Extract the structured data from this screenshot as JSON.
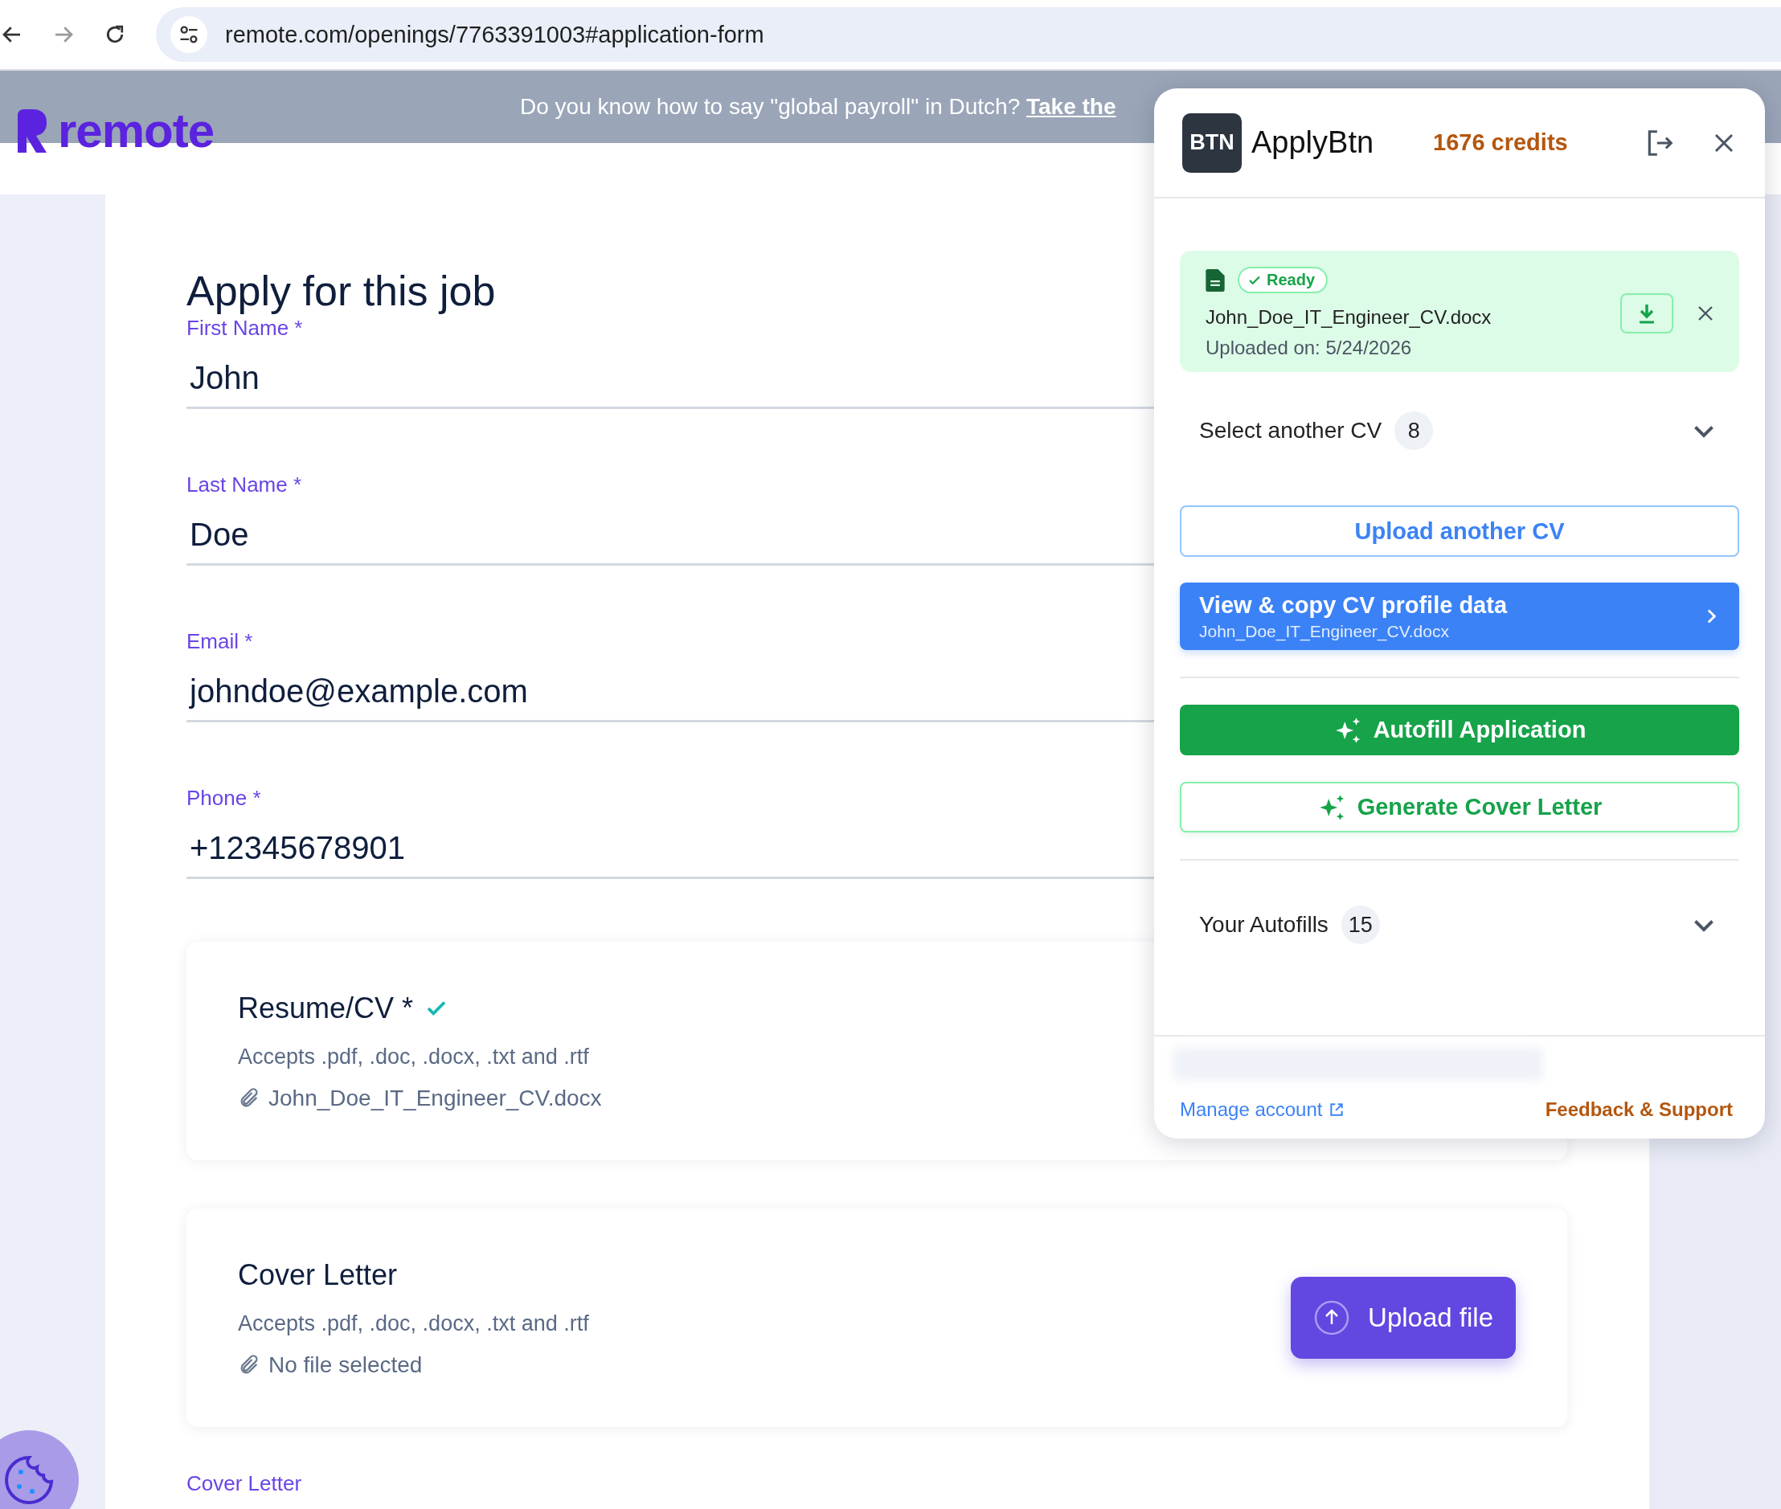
{
  "browser": {
    "url": "remote.com/openings/7763391003#application-form"
  },
  "banner": {
    "text": "Do you know how to say \"global payroll\" in Dutch?",
    "link": "Take the"
  },
  "logo": {
    "text": "remote"
  },
  "form": {
    "title": "Apply for this job",
    "fields": [
      {
        "label": "First Name *",
        "value": "John"
      },
      {
        "label": "Last Name *",
        "value": "Doe"
      },
      {
        "label": "Email *",
        "value": "johndoe@example.com"
      },
      {
        "label": "Phone *",
        "value": "+12345678901"
      }
    ],
    "uploads": [
      {
        "title": "Resume/CV *",
        "done": true,
        "accepts": "Accepts .pdf, .doc, .docx, .txt and .rtf",
        "file": "John_Doe_IT_Engineer_CV.docx"
      },
      {
        "title": "Cover Letter",
        "done": false,
        "accepts": "Accepts .pdf, .doc, .docx, .txt and .rtf",
        "file": "No file selected",
        "button": "Upload file"
      }
    ],
    "next_label": "Cover Letter"
  },
  "panel": {
    "logo": "BTN",
    "name": "ApplyBtn",
    "credits": "1676 credits",
    "cv": {
      "status": "Ready",
      "file": "John_Doe_IT_Engineer_CV.docx",
      "uploaded": "Uploaded on: 5/24/2026"
    },
    "select": {
      "label": "Select another CV",
      "count": "8",
      "expanded": false
    },
    "upload_button": "Upload another CV",
    "profile_button": {
      "title": "View & copy CV profile data",
      "subtitle": "John_Doe_IT_Engineer_CV.docx"
    },
    "autofill_button": "Autofill Application",
    "cover_button": "Generate Cover Letter",
    "autofills": {
      "label": "Your Autofills",
      "count": "15",
      "expanded": false
    },
    "footer": {
      "manage": "Manage account",
      "feedback": "Feedback & Support"
    }
  }
}
